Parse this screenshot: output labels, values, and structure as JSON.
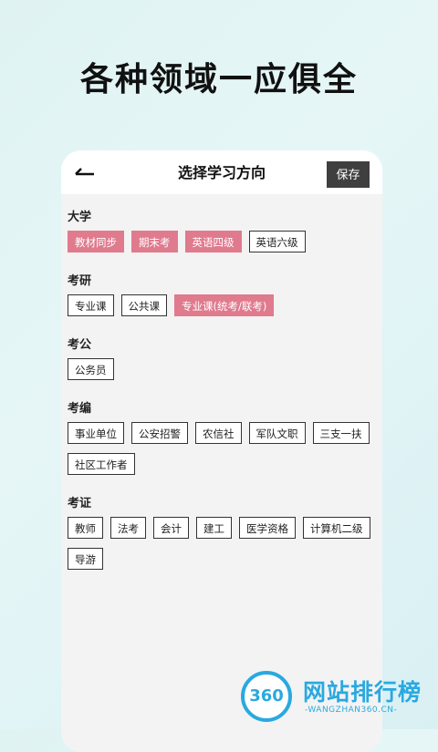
{
  "headline": "各种领域一应俱全",
  "header": {
    "title": "选择学习方向",
    "save_label": "保存"
  },
  "sections": [
    {
      "title": "大学",
      "tags": [
        {
          "label": "教材同步",
          "selected": true
        },
        {
          "label": "期末考",
          "selected": true
        },
        {
          "label": "英语四级",
          "selected": true
        },
        {
          "label": "英语六级",
          "selected": false
        }
      ]
    },
    {
      "title": "考研",
      "tags": [
        {
          "label": "专业课",
          "selected": false
        },
        {
          "label": "公共课",
          "selected": false
        },
        {
          "label": "专业课(统考/联考)",
          "selected": true
        }
      ]
    },
    {
      "title": "考公",
      "tags": [
        {
          "label": "公务员",
          "selected": false
        }
      ]
    },
    {
      "title": "考编",
      "tags": [
        {
          "label": "事业单位",
          "selected": false
        },
        {
          "label": "公安招警",
          "selected": false
        },
        {
          "label": "农信社",
          "selected": false
        },
        {
          "label": "军队文职",
          "selected": false
        },
        {
          "label": "三支一扶",
          "selected": false
        },
        {
          "label": "社区工作者",
          "selected": false
        }
      ]
    },
    {
      "title": "考证",
      "tags": [
        {
          "label": "教师",
          "selected": false
        },
        {
          "label": "法考",
          "selected": false
        },
        {
          "label": "会计",
          "selected": false
        },
        {
          "label": "建工",
          "selected": false
        },
        {
          "label": "医学资格",
          "selected": false
        },
        {
          "label": "计算机二级",
          "selected": false
        },
        {
          "label": "导游",
          "selected": false
        }
      ]
    }
  ],
  "watermark": {
    "badge": "360",
    "name": "网站排行榜",
    "domain": "WANGZHAN360.CN"
  },
  "colors": {
    "selected": "#e07a8d",
    "accent": "#29a9e0"
  },
  "icons": {
    "back": "back-arrow-icon"
  }
}
